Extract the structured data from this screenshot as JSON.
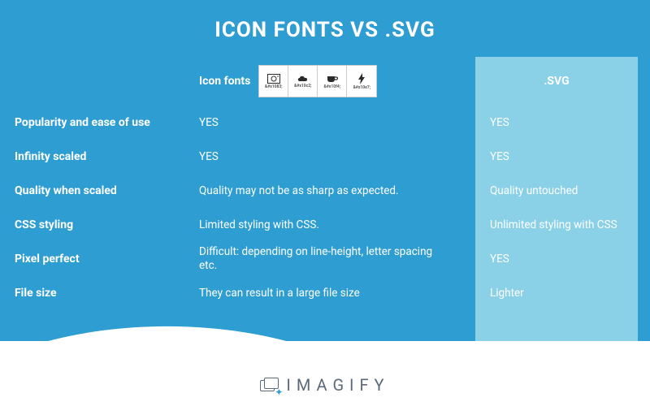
{
  "title": "ICON FONTS VS .SVG",
  "columns": {
    "iconfonts_header": "Icon fonts",
    "svg_header": ".SVG"
  },
  "iconfont_sample_codes": [
    "&#x1083;",
    "&#x10c2;",
    "&#x10f4;",
    "&#x10e7;"
  ],
  "rows": [
    {
      "label": "Popularity and ease of use",
      "iconfonts": "YES",
      "svg": "YES"
    },
    {
      "label": "Infinity scaled",
      "iconfonts": "YES",
      "svg": "YES"
    },
    {
      "label": "Quality when scaled",
      "iconfonts": "Quality may not be as sharp as expected.",
      "svg": "Quality untouched"
    },
    {
      "label": "CSS styling",
      "iconfonts": "Limited styling with CSS.",
      "svg": "Unlimited styling with CSS"
    },
    {
      "label": "Pixel perfect",
      "iconfonts": "Difficult: depending on line-height, letter spacing etc.",
      "svg": "YES"
    },
    {
      "label": "File size",
      "iconfonts": "They can result in a large file size",
      "svg": "Lighter"
    }
  ],
  "brand": "IMAGIFY"
}
